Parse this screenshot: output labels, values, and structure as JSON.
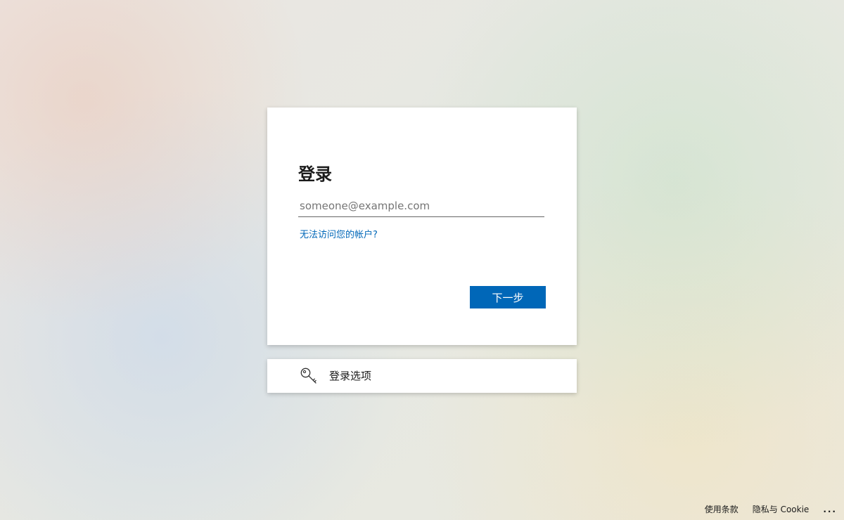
{
  "signin": {
    "title": "登录",
    "email_placeholder": "someone@example.com",
    "email_value": "",
    "help_link": "无法访问您的帐户?",
    "next_button": "下一步"
  },
  "options": {
    "icon": "key-icon",
    "label": "登录选项"
  },
  "footer": {
    "terms": "使用条款",
    "privacy": "隐私与 Cookie",
    "more": "..."
  },
  "colors": {
    "accent": "#0067b8",
    "text": "#1b1b1b",
    "placeholder": "#757575"
  }
}
